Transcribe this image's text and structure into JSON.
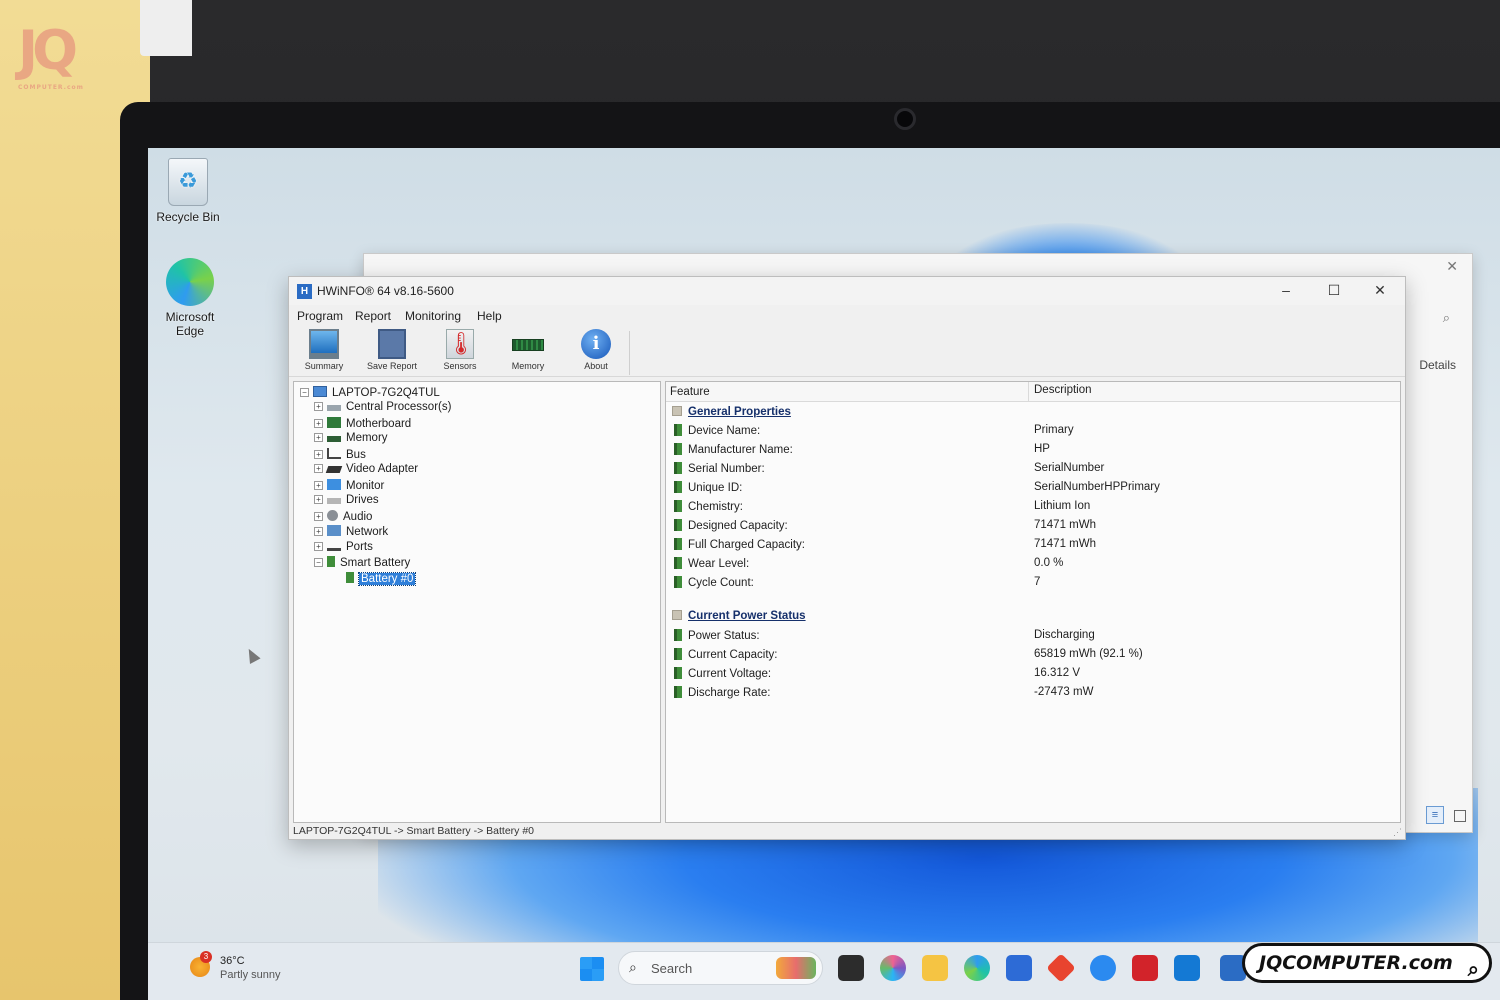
{
  "photo": {
    "logo_mark": "JQ",
    "logo_sub": "COMPUTER.com",
    "watermark": "JQCOMPUTER.com"
  },
  "desktop": {
    "icons": [
      {
        "label": "Recycle Bin",
        "icon": "recycle-bin-icon"
      },
      {
        "label": "Microsoft Edge",
        "icon": "edge-icon"
      }
    ]
  },
  "back_window": {
    "details_label": "Details",
    "close_glyph": "✕",
    "search_glyph": "⌕"
  },
  "window": {
    "title": "HWiNFO® 64 v8.16-5600",
    "controls": {
      "minimize": "–",
      "maximize": "☐",
      "close": "✕"
    },
    "menu": [
      "Program",
      "Report",
      "Monitoring",
      "Help"
    ],
    "toolbar": [
      {
        "label": "Summary",
        "icon": "monitor-icon"
      },
      {
        "label": "Save Report",
        "icon": "floppy-disk-icon"
      },
      {
        "label": "Sensors",
        "icon": "thermometer-icon"
      },
      {
        "label": "Memory",
        "icon": "ram-stick-icon"
      },
      {
        "label": "About",
        "icon": "info-icon"
      }
    ],
    "tree": {
      "root": "LAPTOP-7G2Q4TUL",
      "nodes": [
        "Central Processor(s)",
        "Motherboard",
        "Memory",
        "Bus",
        "Video Adapter",
        "Monitor",
        "Drives",
        "Audio",
        "Network",
        "Ports",
        "Smart Battery"
      ],
      "selected_child": "Battery #0"
    },
    "details": {
      "col_feature": "Feature",
      "col_description": "Description",
      "sections": [
        {
          "title": "General Properties",
          "rows": [
            {
              "feature": "Device Name:",
              "value": "Primary"
            },
            {
              "feature": "Manufacturer Name:",
              "value": "HP"
            },
            {
              "feature": "Serial Number:",
              "value": "SerialNumber"
            },
            {
              "feature": "Unique ID:",
              "value": "SerialNumberHPPrimary"
            },
            {
              "feature": "Chemistry:",
              "value": "Lithium Ion"
            },
            {
              "feature": "Designed Capacity:",
              "value": "71471 mWh"
            },
            {
              "feature": "Full Charged Capacity:",
              "value": "71471 mWh"
            },
            {
              "feature": "Wear Level:",
              "value": "0.0 %"
            },
            {
              "feature": "Cycle Count:",
              "value": "7"
            }
          ]
        },
        {
          "title": "Current Power Status",
          "rows": [
            {
              "feature": "Power Status:",
              "value": "Discharging"
            },
            {
              "feature": "Current Capacity:",
              "value": "65819 mWh (92.1 %)"
            },
            {
              "feature": "Current Voltage:",
              "value": "16.312 V"
            },
            {
              "feature": "Discharge Rate:",
              "value": "-27473 mW"
            }
          ]
        }
      ]
    },
    "status_bar": "LAPTOP-7G2Q4TUL -> Smart Battery -> Battery #0"
  },
  "taskbar": {
    "weather": {
      "badge": "3",
      "temp": "36°C",
      "condition": "Partly sunny"
    },
    "search_placeholder": "Search",
    "apps": [
      "task-view-icon",
      "copilot-icon",
      "file-explorer-icon",
      "edge-icon",
      "store-icon",
      "office-icon",
      "help-icon",
      "mcafee-icon",
      "outlook-icon",
      "hwinfo-icon"
    ]
  },
  "colors": {
    "selection": "#2f7fd9",
    "section_heading": "#16306b",
    "prop_icon": "#3f8d3a",
    "wallpaper_bloom": "#1357d9"
  }
}
